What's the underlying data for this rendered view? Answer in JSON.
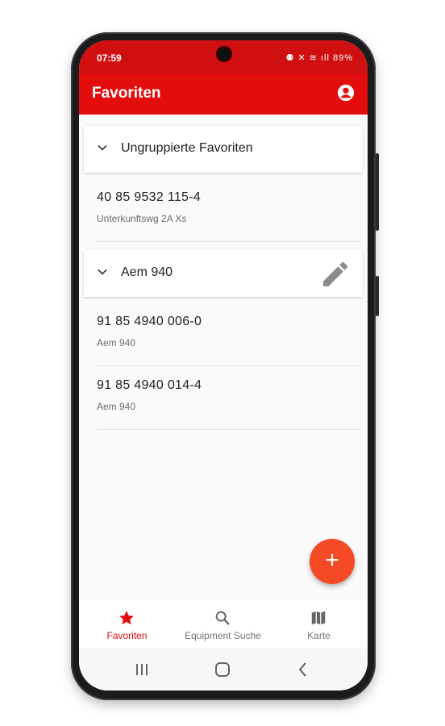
{
  "status_bar": {
    "time": "07:59",
    "battery": "89%"
  },
  "app_bar": {
    "title": "Favoriten",
    "account_icon": "account-circle-icon"
  },
  "groups": [
    {
      "title": "Ungruppierte Favoriten",
      "items": [
        {
          "number": "40 85 9532 115-4",
          "subtitle": "Unterkunftswg 2A Xs"
        }
      ]
    },
    {
      "title": "Aem 940",
      "edit_icon": "pencil-icon",
      "items": [
        {
          "number": "91 85 4940 006-0",
          "subtitle": "Aem 940"
        },
        {
          "number": "91 85 4940 014-4",
          "subtitle": "Aem 940"
        }
      ]
    }
  ],
  "fab": {
    "label": "+"
  },
  "bottom_nav": [
    {
      "label": "Favoriten",
      "icon": "star-icon",
      "active": true
    },
    {
      "label": "Equipment Suche",
      "icon": "search-icon",
      "active": false
    },
    {
      "label": "Karte",
      "icon": "map-icon",
      "active": false
    }
  ],
  "colors": {
    "primary": "#e40d0d",
    "status_bar": "#d01010",
    "fab": "#f44a26"
  }
}
